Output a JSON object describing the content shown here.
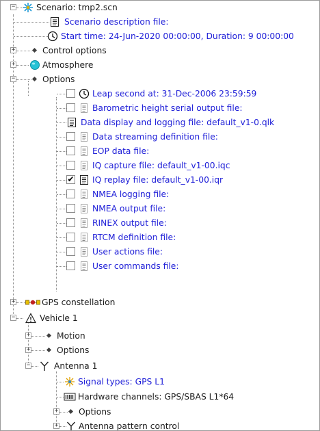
{
  "tree": {
    "scenario": {
      "label": "Scenario: tmp2.scn",
      "icon": "scenario-star-icon"
    },
    "scenario_description": {
      "label": "Scenario description file:",
      "icon": "document-icon"
    },
    "start_time": {
      "label": "Start time: 24-Jun-2020 00:00:00, Duration: 9 00:00:00",
      "icon": "clock-icon"
    },
    "control_options": {
      "label": "Control options"
    },
    "atmosphere": {
      "label": "Atmosphere",
      "icon": "globe-icon"
    },
    "options": {
      "label": "Options",
      "items": [
        {
          "label": "Leap second at: 31-Dec-2006 23:59:59",
          "icon": "clock-icon",
          "checked": false,
          "checkbox": true
        },
        {
          "label": "Barometric height serial output file:",
          "icon": "file-icon",
          "checked": false,
          "checkbox": true
        },
        {
          "label": "Data display and logging file: default_v1-0.qlk",
          "icon": "document-icon",
          "checked": false,
          "checkbox": false
        },
        {
          "label": "Data streaming definition file:",
          "icon": "file-icon",
          "checked": false,
          "checkbox": true
        },
        {
          "label": "EOP data file:",
          "icon": "file-icon",
          "checked": false,
          "checkbox": true
        },
        {
          "label": "IQ capture file: default_v1-00.iqc",
          "icon": "file-icon",
          "checked": false,
          "checkbox": true
        },
        {
          "label": "IQ replay file: default_v1-00.iqr",
          "icon": "document-icon",
          "checked": true,
          "checkbox": true
        },
        {
          "label": "NMEA logging file:",
          "icon": "file-icon",
          "checked": false,
          "checkbox": true
        },
        {
          "label": "NMEA output file:",
          "icon": "file-icon",
          "checked": false,
          "checkbox": true
        },
        {
          "label": "RINEX output file:",
          "icon": "file-icon",
          "checked": false,
          "checkbox": true
        },
        {
          "label": "RTCM definition file:",
          "icon": "file-icon",
          "checked": false,
          "checkbox": true
        },
        {
          "label": "User actions file:",
          "icon": "file-icon",
          "checked": false,
          "checkbox": true
        },
        {
          "label": "User commands file:",
          "icon": "file-icon",
          "checked": false,
          "checkbox": true
        }
      ]
    },
    "gps_constellation": {
      "label": "GPS constellation",
      "icon": "satellite-constellation-icon"
    },
    "vehicle": {
      "label": "Vehicle 1",
      "icon": "vehicle-triangle-icon"
    },
    "motion": {
      "label": "Motion"
    },
    "vehicle_options": {
      "label": "Options"
    },
    "antenna": {
      "label": "Antenna  1",
      "icon": "antenna-icon"
    },
    "signal_types": {
      "label": "Signal types: GPS L1",
      "icon": "signal-star-icon"
    },
    "hardware_channels": {
      "label": "Hardware channels: GPS/SBAS L1*64",
      "icon": "hardware-channels-icon"
    },
    "antenna_options": {
      "label": "Options"
    },
    "antenna_pattern": {
      "label": "Antenna pattern control",
      "icon": "antenna-icon"
    }
  },
  "colors": {
    "link": "#2020d8",
    "plain": "#1c1c1c",
    "check": "#000000"
  },
  "expander": {
    "expanded": "−",
    "collapsed": "+"
  },
  "check_mark": "✔"
}
